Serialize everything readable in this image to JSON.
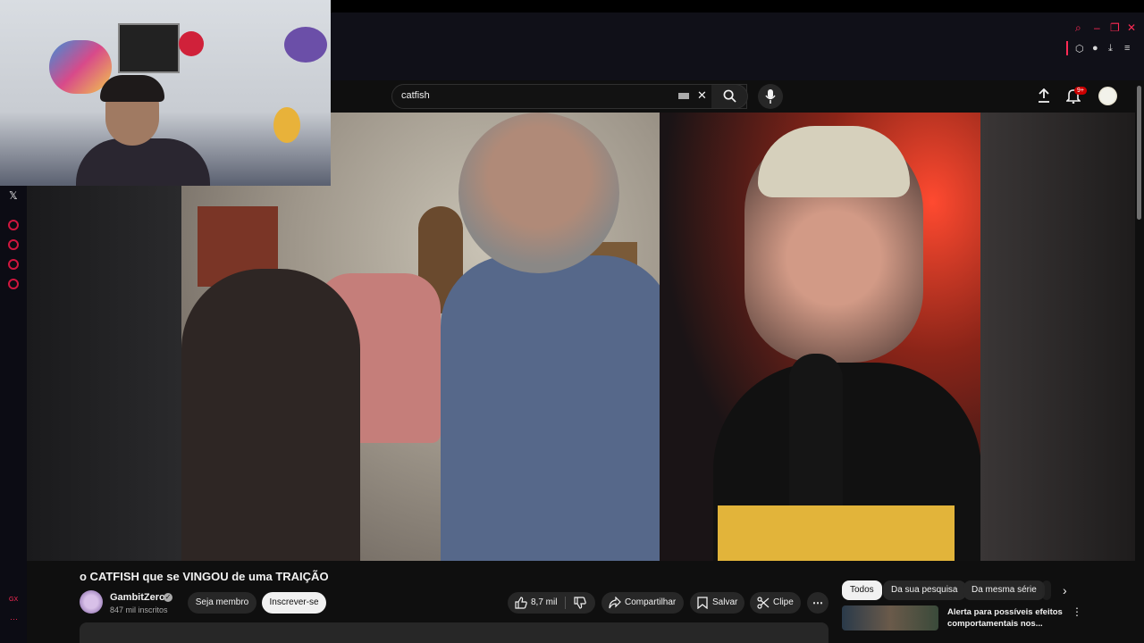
{
  "search": {
    "query": "catfish"
  },
  "header": {
    "notification_badge": "9+"
  },
  "video": {
    "title": "o CATFISH que se VINGOU de uma TRAIÇÃO",
    "channel_name": "GambitZero",
    "subscribers": "847 mil inscritos",
    "member_label": "Seja membro",
    "subscribe_label": "Inscrever-se",
    "likes": "8,7 mil",
    "share_label": "Compartilhar",
    "save_label": "Salvar",
    "clip_label": "Clipe"
  },
  "chips": [
    "Todos",
    "Da sua pesquisa",
    "Da mesma série"
  ],
  "recommended": {
    "title": "Alerta para possíveis efeitos comportamentais nos..."
  },
  "sidebar": {
    "gx_label": "GX"
  },
  "colors": {
    "accent": "#ff2a55",
    "youtube_bg": "#0f0f0f",
    "subscribe_bg": "#f1f1f1"
  }
}
